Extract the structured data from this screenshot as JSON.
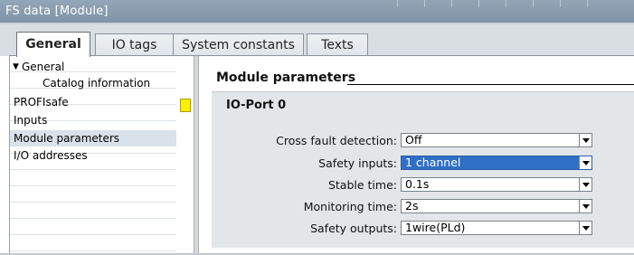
{
  "window": {
    "title": "FS data [Module]"
  },
  "tabs": [
    {
      "label": "General",
      "active": true
    },
    {
      "label": "IO tags",
      "active": false
    },
    {
      "label": "System constants",
      "active": false
    },
    {
      "label": "Texts",
      "active": false
    }
  ],
  "nav": {
    "items": [
      {
        "label": "General",
        "expanded": true
      },
      {
        "label": "Catalog information"
      },
      {
        "label": "PROFIsafe",
        "status_color": "#ffef00"
      },
      {
        "label": "Inputs"
      },
      {
        "label": "Module parameters",
        "selected": true
      },
      {
        "label": "I/O addresses"
      }
    ],
    "expand_icon": "triangle-down-icon"
  },
  "main": {
    "section_title": "Module parameters",
    "group_title": "IO-Port 0",
    "params": [
      {
        "label": "Cross fault detection:",
        "value": "Off"
      },
      {
        "label": "Safety inputs:",
        "value": "1 channel",
        "highlighted": true
      },
      {
        "label": "Stable time:",
        "value": "0.1s"
      },
      {
        "label": "Monitoring time:",
        "value": "2s"
      },
      {
        "label": "Safety outputs:",
        "value": "1wire(PLd)"
      }
    ]
  },
  "colors": {
    "titlebar": "#8a9eb0",
    "selection": "#2f6fc6",
    "nav_selected": "#d9e1ea",
    "panel": "#e3e6e8"
  }
}
